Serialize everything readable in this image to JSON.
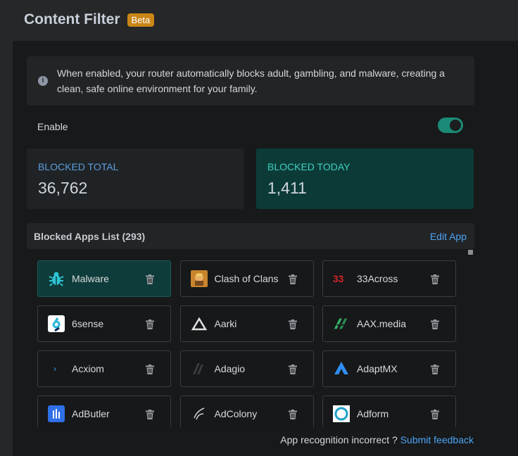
{
  "header": {
    "title": "Content Filter",
    "badge": "Beta"
  },
  "info": {
    "icon": "info-icon",
    "text": "When enabled, your router automatically blocks adult, gambling, and malware, creating a clean, safe online environment for your family."
  },
  "enable": {
    "label": "Enable",
    "state": "on",
    "accent_color": "#1b8a76"
  },
  "stats": {
    "total": {
      "label": "BLOCKED TOTAL",
      "value": "36,762"
    },
    "today": {
      "label": "BLOCKED TODAY",
      "value": "1,411"
    }
  },
  "blocked_list": {
    "title": "Blocked Apps List (293)",
    "edit_label": "Edit App",
    "apps": [
      {
        "name": "Malware",
        "icon": "bug-icon",
        "active": true
      },
      {
        "name": "Clash of Clans",
        "icon": "clash-of-clans-icon",
        "active": false
      },
      {
        "name": "33Across",
        "icon": "33across-icon",
        "active": false
      },
      {
        "name": "6sense",
        "icon": "6sense-icon",
        "active": false
      },
      {
        "name": "Aarki",
        "icon": "aarki-icon",
        "active": false
      },
      {
        "name": "AAX.media",
        "icon": "aax-media-icon",
        "active": false
      },
      {
        "name": "Acxiom",
        "icon": "acxiom-icon",
        "active": false
      },
      {
        "name": "Adagio",
        "icon": "adagio-icon",
        "active": false
      },
      {
        "name": "AdaptMX",
        "icon": "adaptmx-icon",
        "active": false
      },
      {
        "name": "AdButler",
        "icon": "adbutler-icon",
        "active": false
      },
      {
        "name": "AdColony",
        "icon": "adcolony-icon",
        "active": false
      },
      {
        "name": "Adform",
        "icon": "adform-icon",
        "active": false
      }
    ]
  },
  "footer": {
    "text": "App recognition incorrect ?",
    "link": "Submit feedback"
  }
}
